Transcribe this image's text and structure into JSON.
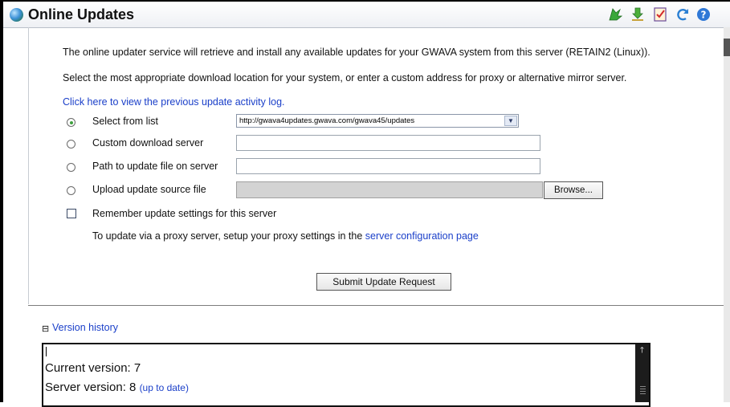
{
  "window": {
    "title": "Online Updates"
  },
  "toolbar": {
    "icons": [
      "runner-icon",
      "download-icon",
      "checklist-icon",
      "refresh-icon",
      "help-icon"
    ]
  },
  "intro": {
    "line1": "The online updater service will retrieve and install any available updates for your GWAVA system from this server (RETAIN2 (Linux)).",
    "line2": "Select the most appropriate download location for your system, or enter a custom address for proxy or alternative mirror server."
  },
  "log_link": "Click here to view the previous update activity log.",
  "options": {
    "select_from_list": "Select from list",
    "custom_server": "Custom download server",
    "path_on_server": "Path to update file on server",
    "upload_source": "Upload update source file",
    "selected": "select_from_list"
  },
  "select": {
    "value": "http://gwava4updates.gwava.com/gwava45/updates"
  },
  "browse_label": "Browse...",
  "remember_label": "Remember update settings for this server",
  "proxy": {
    "text": "To update via a proxy server, setup your proxy settings in the",
    "link": "server configuration page"
  },
  "submit_label": "Submit Update Request",
  "version_history": {
    "toggle": "⊟",
    "label": "Version history",
    "current_label": "Current version:",
    "current_value": "7",
    "server_label": "Server version:",
    "server_value": "8",
    "status": "(up to date)"
  },
  "colors": {
    "link": "#1a3fc9",
    "radio_selected": "#3fa03f"
  }
}
